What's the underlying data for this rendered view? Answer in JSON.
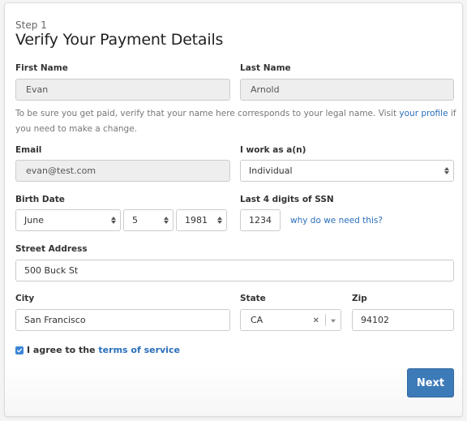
{
  "header": {
    "step": "Step 1",
    "title": "Verify Your Payment Details"
  },
  "fields": {
    "first_name": {
      "label": "First Name",
      "value": "Evan"
    },
    "last_name": {
      "label": "Last Name",
      "value": "Arnold"
    },
    "name_help": {
      "before": "To be sure you get paid, verify that your name here corresponds to your legal name. Visit ",
      "link": "your profile",
      "after": " if you need to make a change."
    },
    "email": {
      "label": "Email",
      "value": "evan@test.com"
    },
    "work_as": {
      "label": "I work as a(n)",
      "value": "Individual"
    },
    "birth_date": {
      "label": "Birth Date",
      "month": "June",
      "day": "5",
      "year": "1981"
    },
    "ssn": {
      "label": "Last 4 digits of SSN",
      "value": "1234",
      "help_link": "why do we need this?"
    },
    "street": {
      "label": "Street Address",
      "value": "500 Buck St"
    },
    "city": {
      "label": "City",
      "value": "San Francisco"
    },
    "state": {
      "label": "State",
      "value": "CA",
      "clear_icon": "×"
    },
    "zip": {
      "label": "Zip",
      "value": "94102"
    }
  },
  "terms": {
    "checked": true,
    "before": "I agree to the ",
    "link": "terms of service"
  },
  "actions": {
    "next_label": "Next"
  },
  "colors": {
    "primary": "#3d7ab8",
    "link": "#2a6ebb",
    "checkbox": "#3b86d6"
  }
}
